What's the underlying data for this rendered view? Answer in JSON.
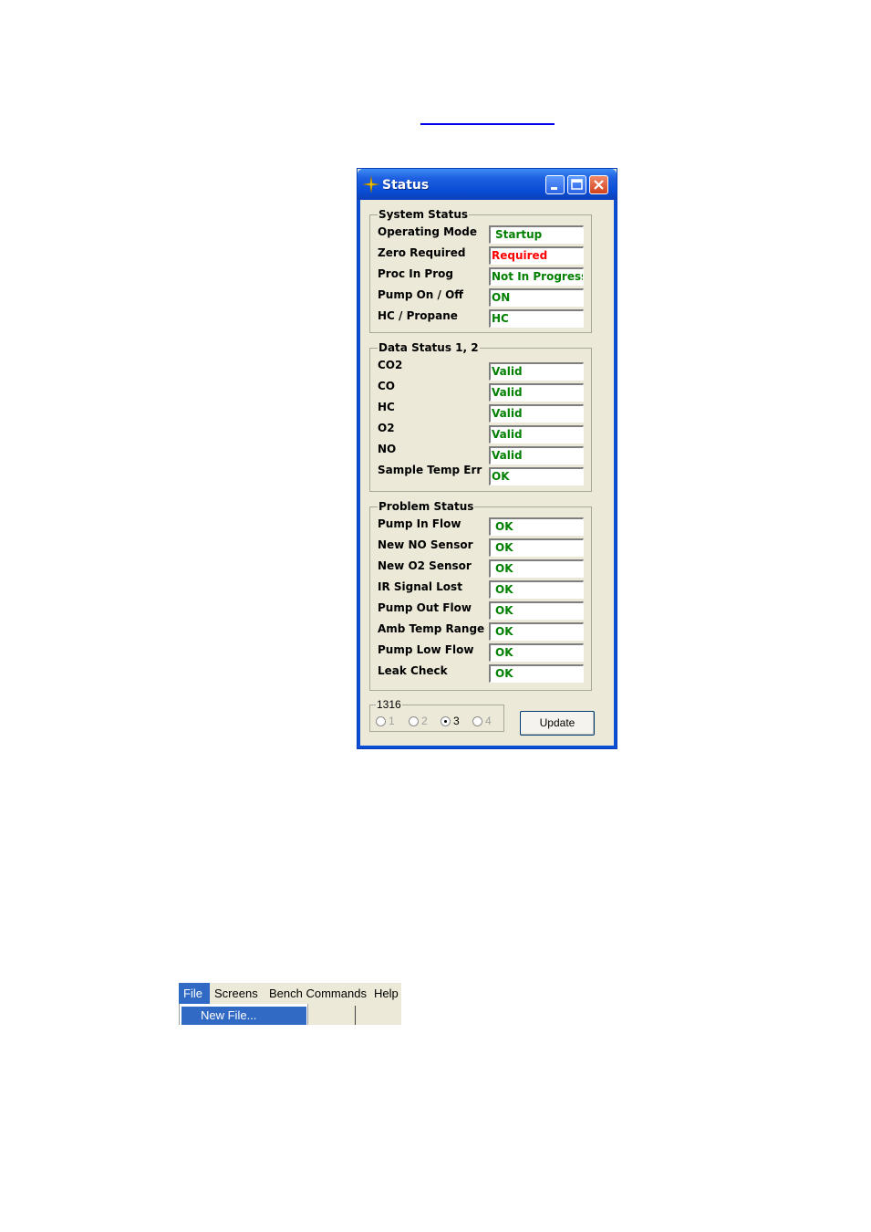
{
  "window": {
    "title": "Status"
  },
  "system_status": {
    "title": "System Status",
    "rows": [
      {
        "label": "Operating Mode",
        "value": "Startup"
      },
      {
        "label": "Zero Required",
        "value": "Required"
      },
      {
        "label": "Proc In Prog",
        "value": "Not In Progress"
      },
      {
        "label": "Pump On / Off",
        "value": "ON"
      },
      {
        "label": "HC / Propane",
        "value": "HC"
      }
    ]
  },
  "data_status": {
    "title": "Data Status 1, 2",
    "rows": [
      {
        "label": "CO2",
        "value": "Valid"
      },
      {
        "label": "CO",
        "value": "Valid"
      },
      {
        "label": "HC",
        "value": "Valid"
      },
      {
        "label": "O2",
        "value": "Valid"
      },
      {
        "label": "NO",
        "value": "Valid"
      },
      {
        "label": "Sample Temp Err",
        "value": "OK"
      }
    ]
  },
  "problem_status": {
    "title": "Problem Status",
    "rows": [
      {
        "label": "Pump In Flow",
        "value": "OK"
      },
      {
        "label": "New NO Sensor",
        "value": "OK"
      },
      {
        "label": "New O2 Sensor",
        "value": "OK"
      },
      {
        "label": "IR Signal Lost",
        "value": "OK"
      },
      {
        "label": "Pump Out Flow",
        "value": "OK"
      },
      {
        "label": "Amb Temp Range",
        "value": "OK"
      },
      {
        "label": "Pump Low Flow",
        "value": "OK"
      },
      {
        "label": "Leak Check",
        "value": "OK"
      }
    ]
  },
  "bench": {
    "title": "1316",
    "options": [
      "1",
      "2",
      "3",
      "4"
    ],
    "selected": "3"
  },
  "update_label": "Update",
  "menu": {
    "items": [
      "File",
      "Screens",
      "Bench Commands",
      "Help"
    ],
    "active": "File",
    "dropdown_item": "New File..."
  },
  "colors": {
    "ok_text": "#008000",
    "alert_text": "#ff0000",
    "titlebar": "#0a4ed6",
    "menu_highlight": "#316ac5"
  }
}
